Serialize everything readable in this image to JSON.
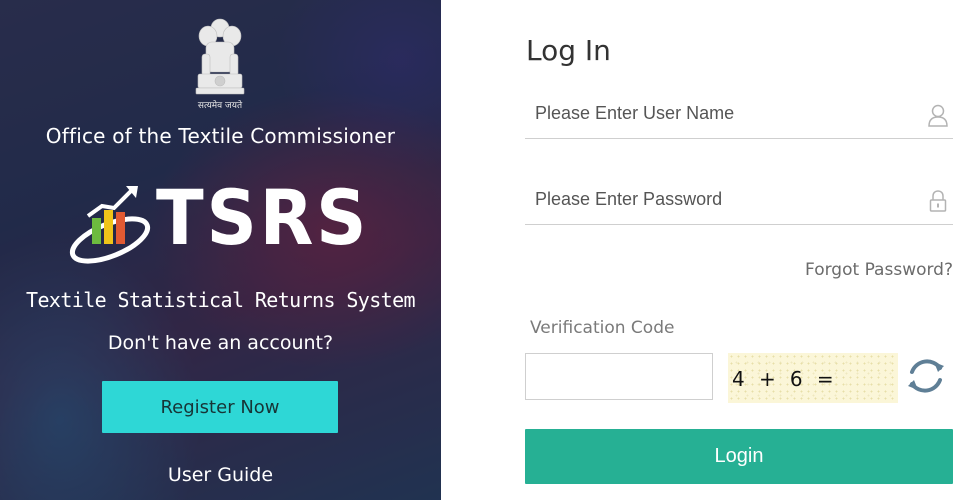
{
  "hero": {
    "emblem_icon": "national-emblem-icon",
    "motto": "सत्यमेव जयते",
    "office_title": "Office of the Textile Commissioner",
    "logo_icon": "bar-chart-growth-icon",
    "logo_text": "TSRS",
    "tagline": "Textile Statistical Returns System",
    "no_account_text": "Don't have an account?",
    "register_label": "Register Now",
    "user_guide_label": "User Guide"
  },
  "login": {
    "title": "Log In",
    "username_placeholder": "Please Enter User Name",
    "username_icon": "user-icon",
    "password_placeholder": "Please Enter Password",
    "password_icon": "lock-icon",
    "forgot_label": "Forgot Password?",
    "verification_label": "Verification Code",
    "captcha_text": "4  +  6  =",
    "refresh_icon": "refresh-icon",
    "login_label": "Login"
  },
  "colors": {
    "register_button": "#2ed7d6",
    "login_button": "#26b094",
    "captcha_background": "#fbf6d8"
  }
}
